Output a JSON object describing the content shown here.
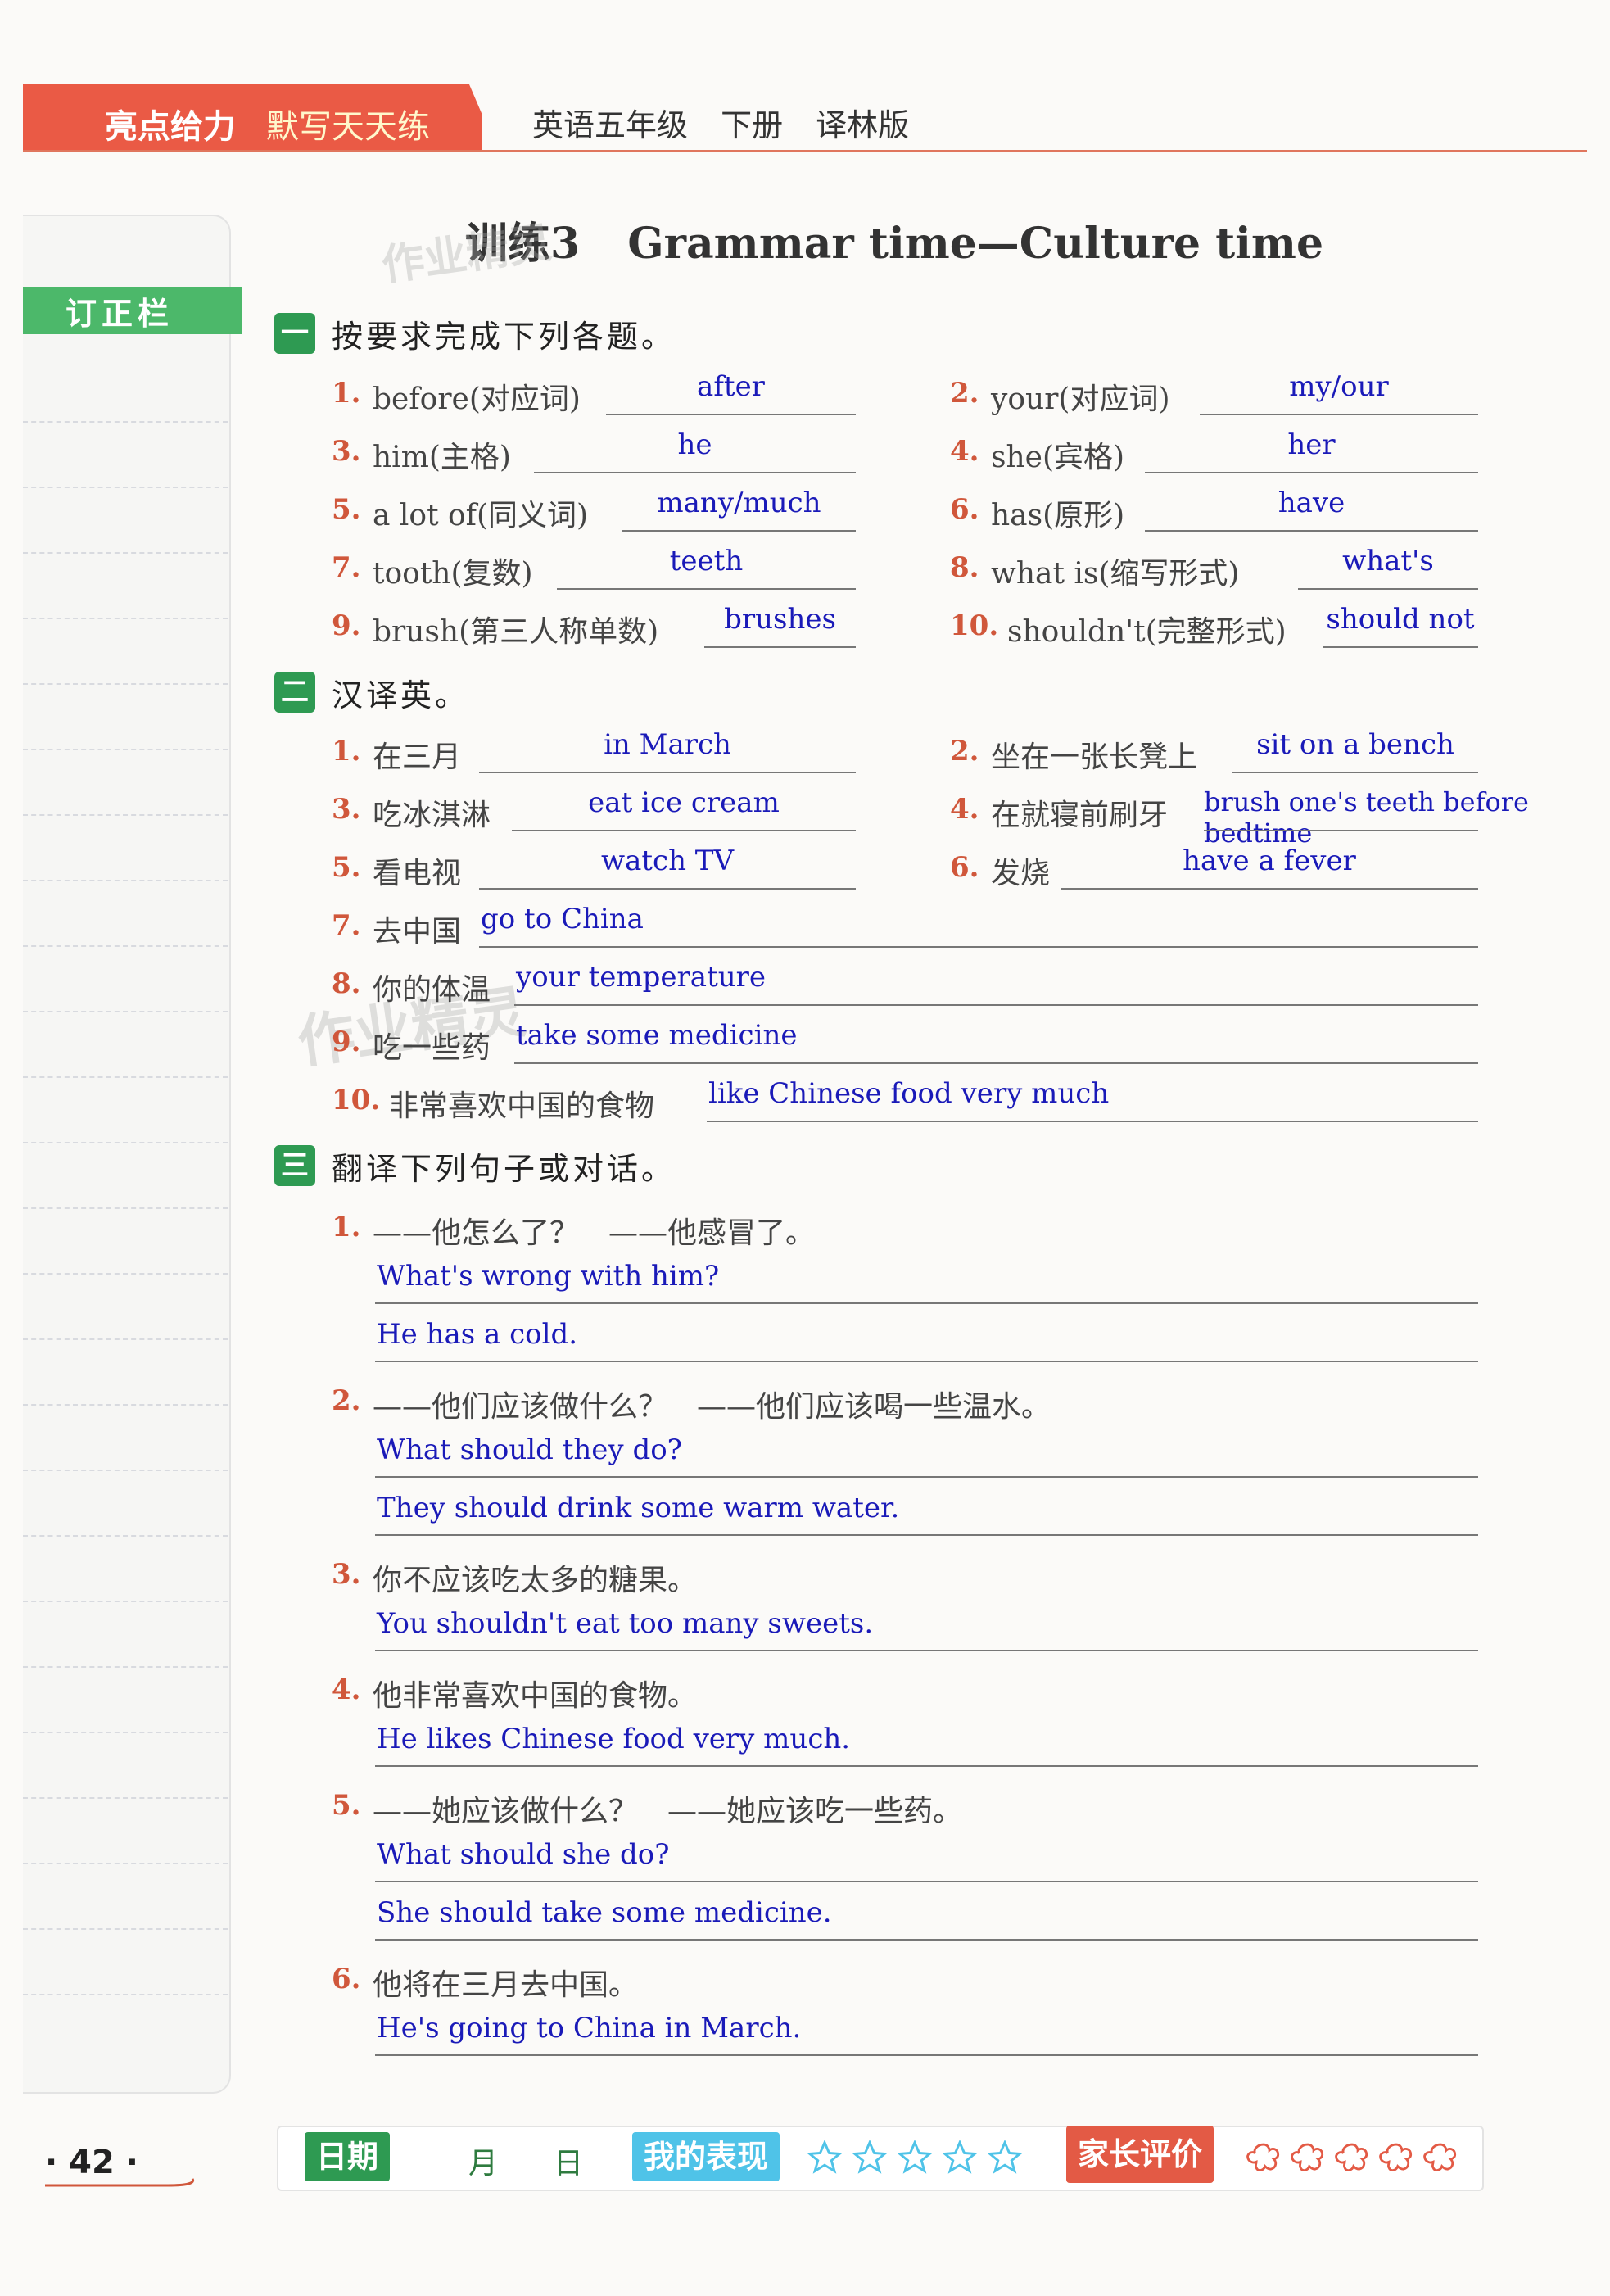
{
  "header": {
    "brand": "亮点给力",
    "series": "默写天天练",
    "book": "英语五年级 下册 译林版"
  },
  "sidebar": {
    "label": "订正栏"
  },
  "title": {
    "cn": "训练3",
    "en": "Grammar time—Culture time"
  },
  "watermark": "作业精灵",
  "sections": {
    "s1": {
      "badge": "一",
      "heading": "按要求完成下列各题。",
      "items": [
        {
          "num": "1.",
          "q": "before(对应词)",
          "a": "after"
        },
        {
          "num": "2.",
          "q": "your(对应词)",
          "a": "my/our"
        },
        {
          "num": "3.",
          "q": "him(主格)",
          "a": "he"
        },
        {
          "num": "4.",
          "q": "she(宾格)",
          "a": "her"
        },
        {
          "num": "5.",
          "q": "a lot of(同义词)",
          "a": "many/much"
        },
        {
          "num": "6.",
          "q": "has(原形)",
          "a": "have"
        },
        {
          "num": "7.",
          "q": "tooth(复数)",
          "a": "teeth"
        },
        {
          "num": "8.",
          "q": "what is(缩写形式)",
          "a": "what's"
        },
        {
          "num": "9.",
          "q": "brush(第三人称单数)",
          "a": "brushes"
        },
        {
          "num": "10.",
          "q": "shouldn't(完整形式)",
          "a": "should not"
        }
      ]
    },
    "s2": {
      "badge": "二",
      "heading": "汉译英。",
      "items": [
        {
          "num": "1.",
          "q": "在三月",
          "a": "in March"
        },
        {
          "num": "2.",
          "q": "坐在一张长凳上",
          "a": "sit on a bench"
        },
        {
          "num": "3.",
          "q": "吃冰淇淋",
          "a": "eat ice cream"
        },
        {
          "num": "4.",
          "q": "在就寝前刷牙",
          "a": "brush one's teeth before bedtime"
        },
        {
          "num": "5.",
          "q": "看电视",
          "a": "watch TV"
        },
        {
          "num": "6.",
          "q": "发烧",
          "a": "have a fever"
        },
        {
          "num": "7.",
          "q": "去中国",
          "a": "go to China"
        },
        {
          "num": "8.",
          "q": "你的体温",
          "a": "your temperature"
        },
        {
          "num": "9.",
          "q": "吃一些药",
          "a": "take some medicine"
        },
        {
          "num": "10.",
          "q": "非常喜欢中国的食物",
          "a": "like Chinese food very much"
        }
      ]
    },
    "s3": {
      "badge": "三",
      "heading": "翻译下列句子或对话。",
      "items": [
        {
          "num": "1.",
          "q": "——他怎么了？　——他感冒了。",
          "a1": "What's wrong with him?",
          "a2": "He has a cold."
        },
        {
          "num": "2.",
          "q": "——他们应该做什么？　——他们应该喝一些温水。",
          "a1": "What should they do?",
          "a2": "They should drink some warm water."
        },
        {
          "num": "3.",
          "q": "你不应该吃太多的糖果。",
          "a1": "You shouldn't eat too many sweets."
        },
        {
          "num": "4.",
          "q": "他非常喜欢中国的食物。",
          "a1": "He likes Chinese food very much."
        },
        {
          "num": "5.",
          "q": "——她应该做什么？　——她应该吃一些药。",
          "a1": "What should she do?",
          "a2": "She should take some medicine."
        },
        {
          "num": "6.",
          "q": "他将在三月去中国。",
          "a1": "He's going to China in March."
        }
      ]
    }
  },
  "footer": {
    "page": "· 42 ·",
    "date_label": "日期",
    "month": "月",
    "day": "日",
    "performance_label": "我的表现",
    "parent_label": "家长评价"
  },
  "colors": {
    "accent": "#ea5a45",
    "green": "#2e9a52",
    "answer": "#1a1ab8",
    "number": "#d0573b",
    "perf": "#4fc3e8",
    "parent": "#e35a45"
  }
}
